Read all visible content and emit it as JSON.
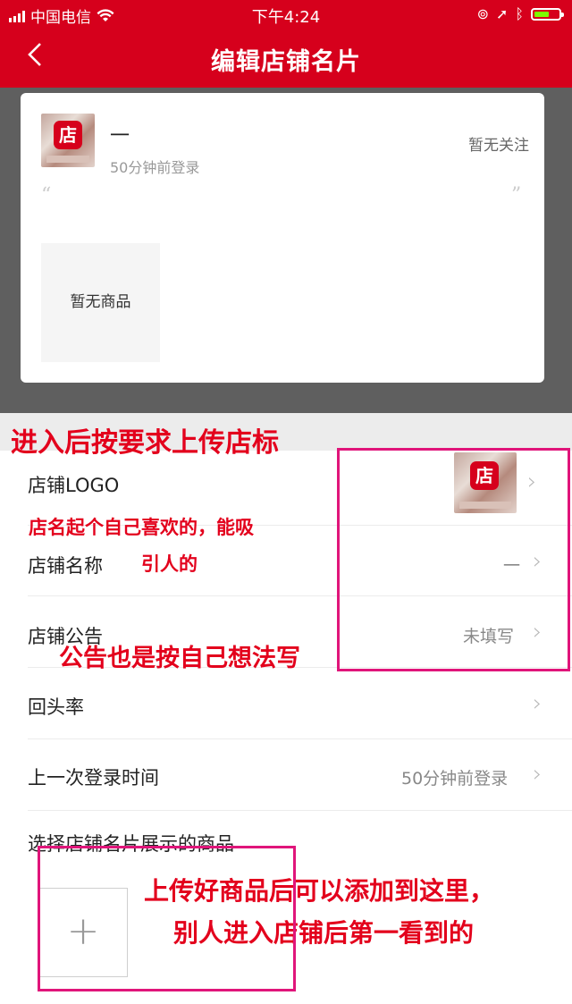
{
  "status_bar": {
    "carrier": "中国电信",
    "time": "下午4:24",
    "battery_level": 0.6,
    "battery_color": "#7CFC00"
  },
  "header": {
    "title": "编辑店铺名片",
    "background": "#d6001c"
  },
  "preview": {
    "logo_char": "店",
    "shop_name": "一",
    "login_time": "50分钟前登录",
    "follow_status": "暂无关注",
    "quote_open": "“",
    "quote_close": "”",
    "no_goods": "暂无商品"
  },
  "settings": {
    "logo_label": "店铺LOGO",
    "name_label": "店铺名称",
    "name_value": "一",
    "notice_label": "店铺公告",
    "notice_value": "未填写",
    "return_rate_label": "回头率",
    "last_login_label": "上一次登录时间",
    "last_login_value": "50分钟前登录",
    "showcase_label": "选择店铺名片展示的商品",
    "add_symbol": "+"
  },
  "annotations": {
    "upload_logo": "进入后按要求上传店标",
    "name_tip_1": "店名起个自己喜欢的，能吸",
    "name_tip_2": "引人的",
    "notice_tip": "公告也是按自己想法写",
    "goods_tip_1": "上传好商品后可以添加到这里，",
    "goods_tip_2": "别人进入店铺后第一看到的",
    "text_color": "#e3001c",
    "box_color": "#e0157a"
  }
}
